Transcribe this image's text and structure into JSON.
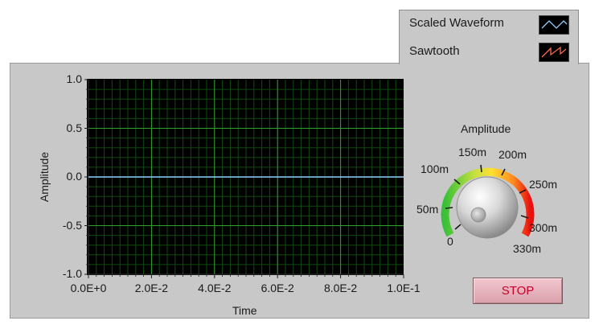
{
  "legend": {
    "items": [
      {
        "label": "Scaled Waveform",
        "color": "#8fd0ff",
        "icon": "triangle-wave-icon"
      },
      {
        "label": "Sawtooth",
        "color": "#ff6a4a",
        "icon": "sawtooth-wave-icon"
      }
    ]
  },
  "chart_data": {
    "type": "line",
    "xlabel": "Time",
    "ylabel": "Amplitude",
    "xlim": [
      0,
      0.1
    ],
    "ylim": [
      -1.0,
      1.0
    ],
    "x_ticks": [
      "0.0E+0",
      "2.0E-2",
      "4.0E-2",
      "6.0E-2",
      "8.0E-2",
      "1.0E-1"
    ],
    "y_ticks": [
      "1.0",
      "0.5",
      "0.0",
      "-0.5",
      "-1.0"
    ],
    "grid": true,
    "series": [
      {
        "x": [
          0,
          0.1
        ],
        "y": [
          0,
          0
        ],
        "color": "#8fd0ff"
      }
    ]
  },
  "knob": {
    "title": "Amplitude",
    "labels": [
      "0",
      "50m",
      "100m",
      "150m",
      "200m",
      "250m",
      "300m",
      "330m"
    ],
    "value": 0
  },
  "stop_button": {
    "label": "STOP"
  },
  "colors": {
    "panel": "#c8c8c8",
    "plot_bg": "#000000",
    "grid_major": "#2ea02e",
    "grid_minor": "#0f4a0f",
    "stop_text": "#c8002a"
  }
}
